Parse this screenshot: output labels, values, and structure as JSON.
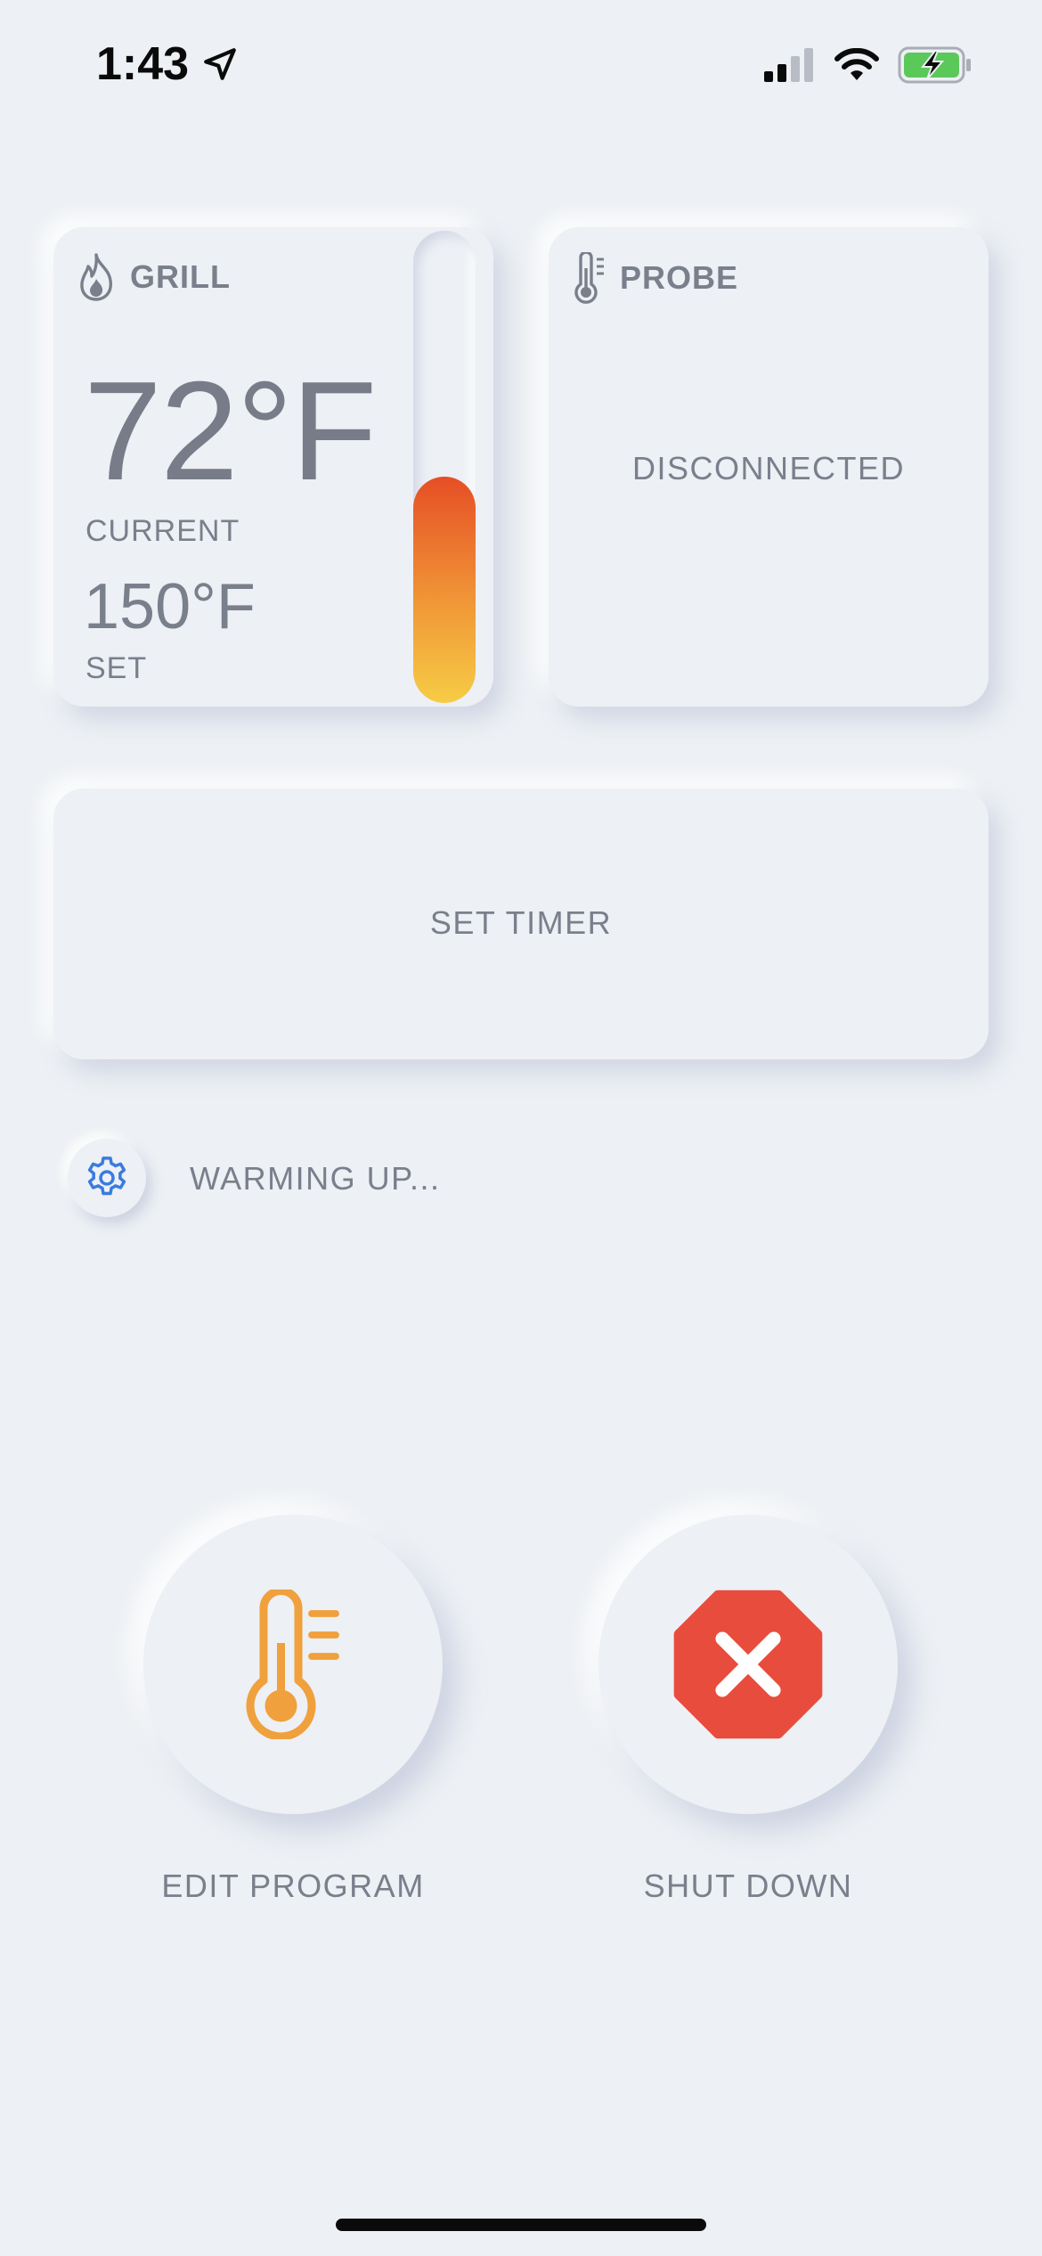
{
  "status_bar": {
    "time": "1:43",
    "location_icon": "location-arrow-icon",
    "signal_icon": "cellular-signal-icon",
    "wifi_icon": "wifi-icon",
    "battery_icon": "battery-charging-icon",
    "signal_bars_active": 2,
    "signal_bars_total": 4
  },
  "grill": {
    "title": "GRILL",
    "icon": "flame-icon",
    "current_temp": "72°F",
    "current_label": "CURRENT",
    "set_temp": "150°F",
    "set_label": "SET",
    "heat_level": 0.48,
    "heat_gradient": [
      "#E64E25",
      "#F09637",
      "#F6CC45"
    ]
  },
  "probe": {
    "title": "PROBE",
    "icon": "thermometer-icon",
    "status": "DISCONNECTED"
  },
  "timer": {
    "label": "SET TIMER"
  },
  "status": {
    "icon": "gear-icon",
    "text": "WARMING UP..."
  },
  "actions": {
    "edit_program": {
      "label": "EDIT PROGRAM",
      "icon": "thermometer-icon",
      "color": "#F0A03C"
    },
    "shut_down": {
      "label": "SHUT DOWN",
      "icon": "stop-octagon-icon",
      "color": "#E84C3D"
    }
  },
  "colors": {
    "background": "#EDF0F4",
    "text": "#7A7F8C",
    "accent_blue": "#3A7BE0",
    "battery_green": "#5BC85A"
  }
}
